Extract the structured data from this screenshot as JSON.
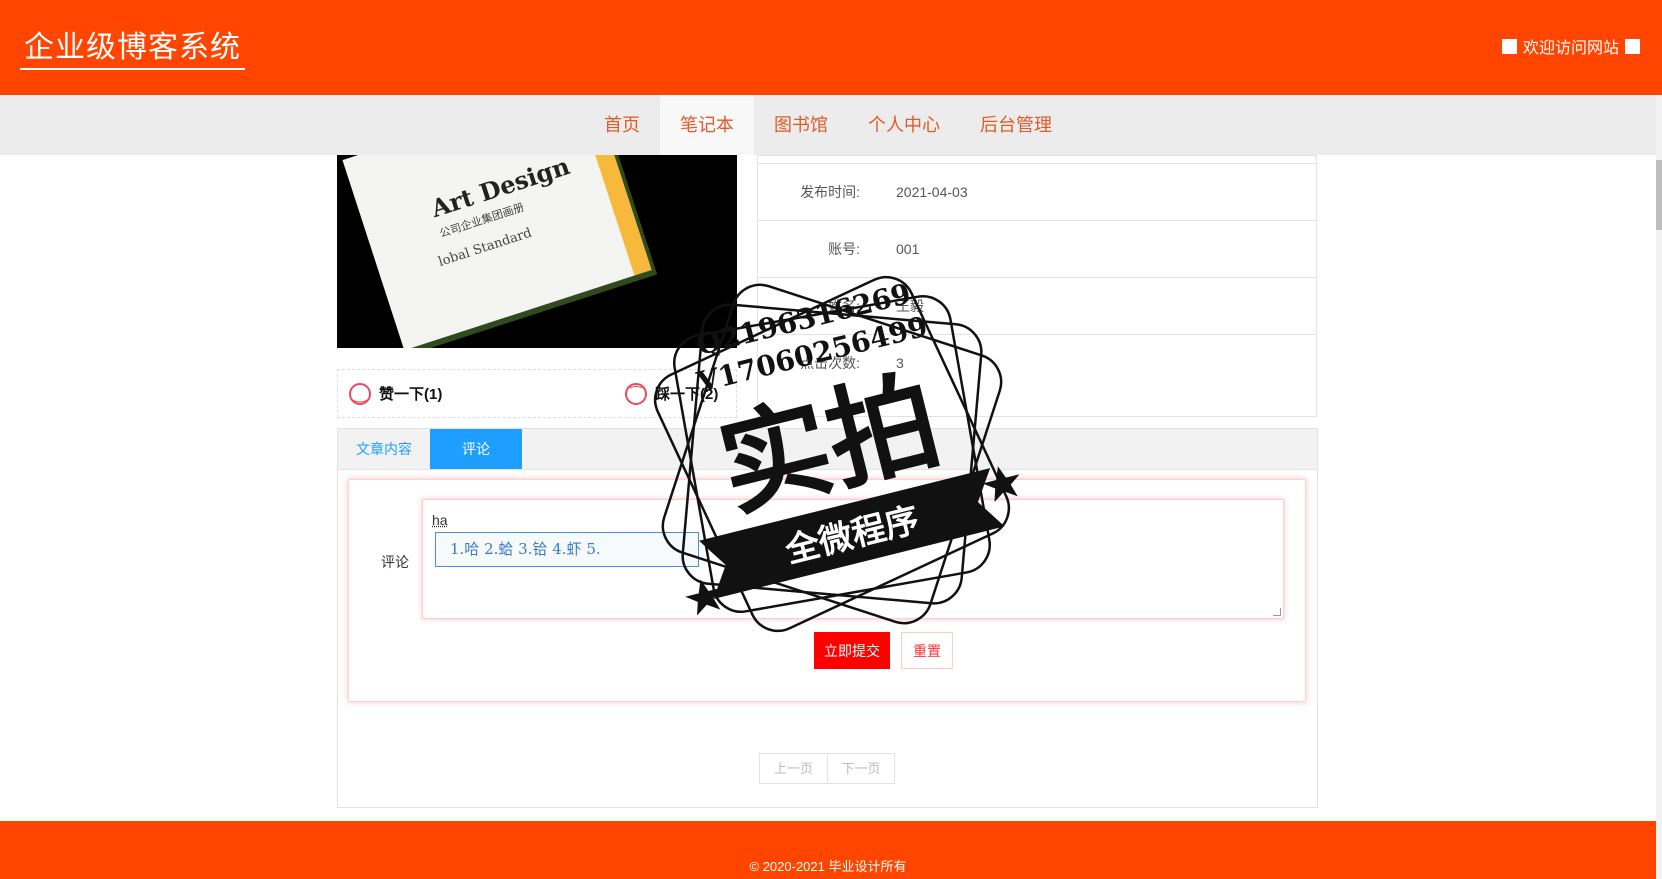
{
  "header": {
    "site_title": "企业级博客系统",
    "welcome": "欢迎访问网站"
  },
  "nav": {
    "items": [
      "首页",
      "笔记本",
      "图书馆",
      "个人中心",
      "后台管理"
    ],
    "active": "笔记本"
  },
  "product_image": {
    "title": "Art Design",
    "subtitle": "公司企业集团画册",
    "standard": "lobal Standard"
  },
  "info": {
    "rows": [
      {
        "label": "发布时间:",
        "value": "2021-04-03"
      },
      {
        "label": "账号:",
        "value": "001"
      },
      {
        "label": "姓名:",
        "value": "王毅"
      },
      {
        "label": "点击次数:",
        "value": "3"
      }
    ]
  },
  "votes": {
    "like_label": "赞一下(1)",
    "dislike_label": "踩一下(2)"
  },
  "tabs": [
    {
      "label": "文章内容",
      "active": false
    },
    {
      "label": "评论",
      "active": true
    }
  ],
  "comment_form": {
    "label": "评论",
    "typed_text": "ha",
    "ime_candidates": "1.哈 2.蛤 3.铪 4.虾 5.",
    "submit_label": "立即提交",
    "reset_label": "重置"
  },
  "pager": {
    "prev_label": "上一页",
    "next_label": "下一页"
  },
  "footer": {
    "copyright": "© 2020-2021 毕业设计所有"
  },
  "watermark": {
    "contact_q": "Q2196316269",
    "contact_v": "V17060256499",
    "main": "实拍",
    "banner": "全微程序"
  },
  "colors": {
    "brand": "#ff4500",
    "nav_bg": "#ececec",
    "tab_active": "#1e9fff",
    "submit": "#ff0000"
  }
}
